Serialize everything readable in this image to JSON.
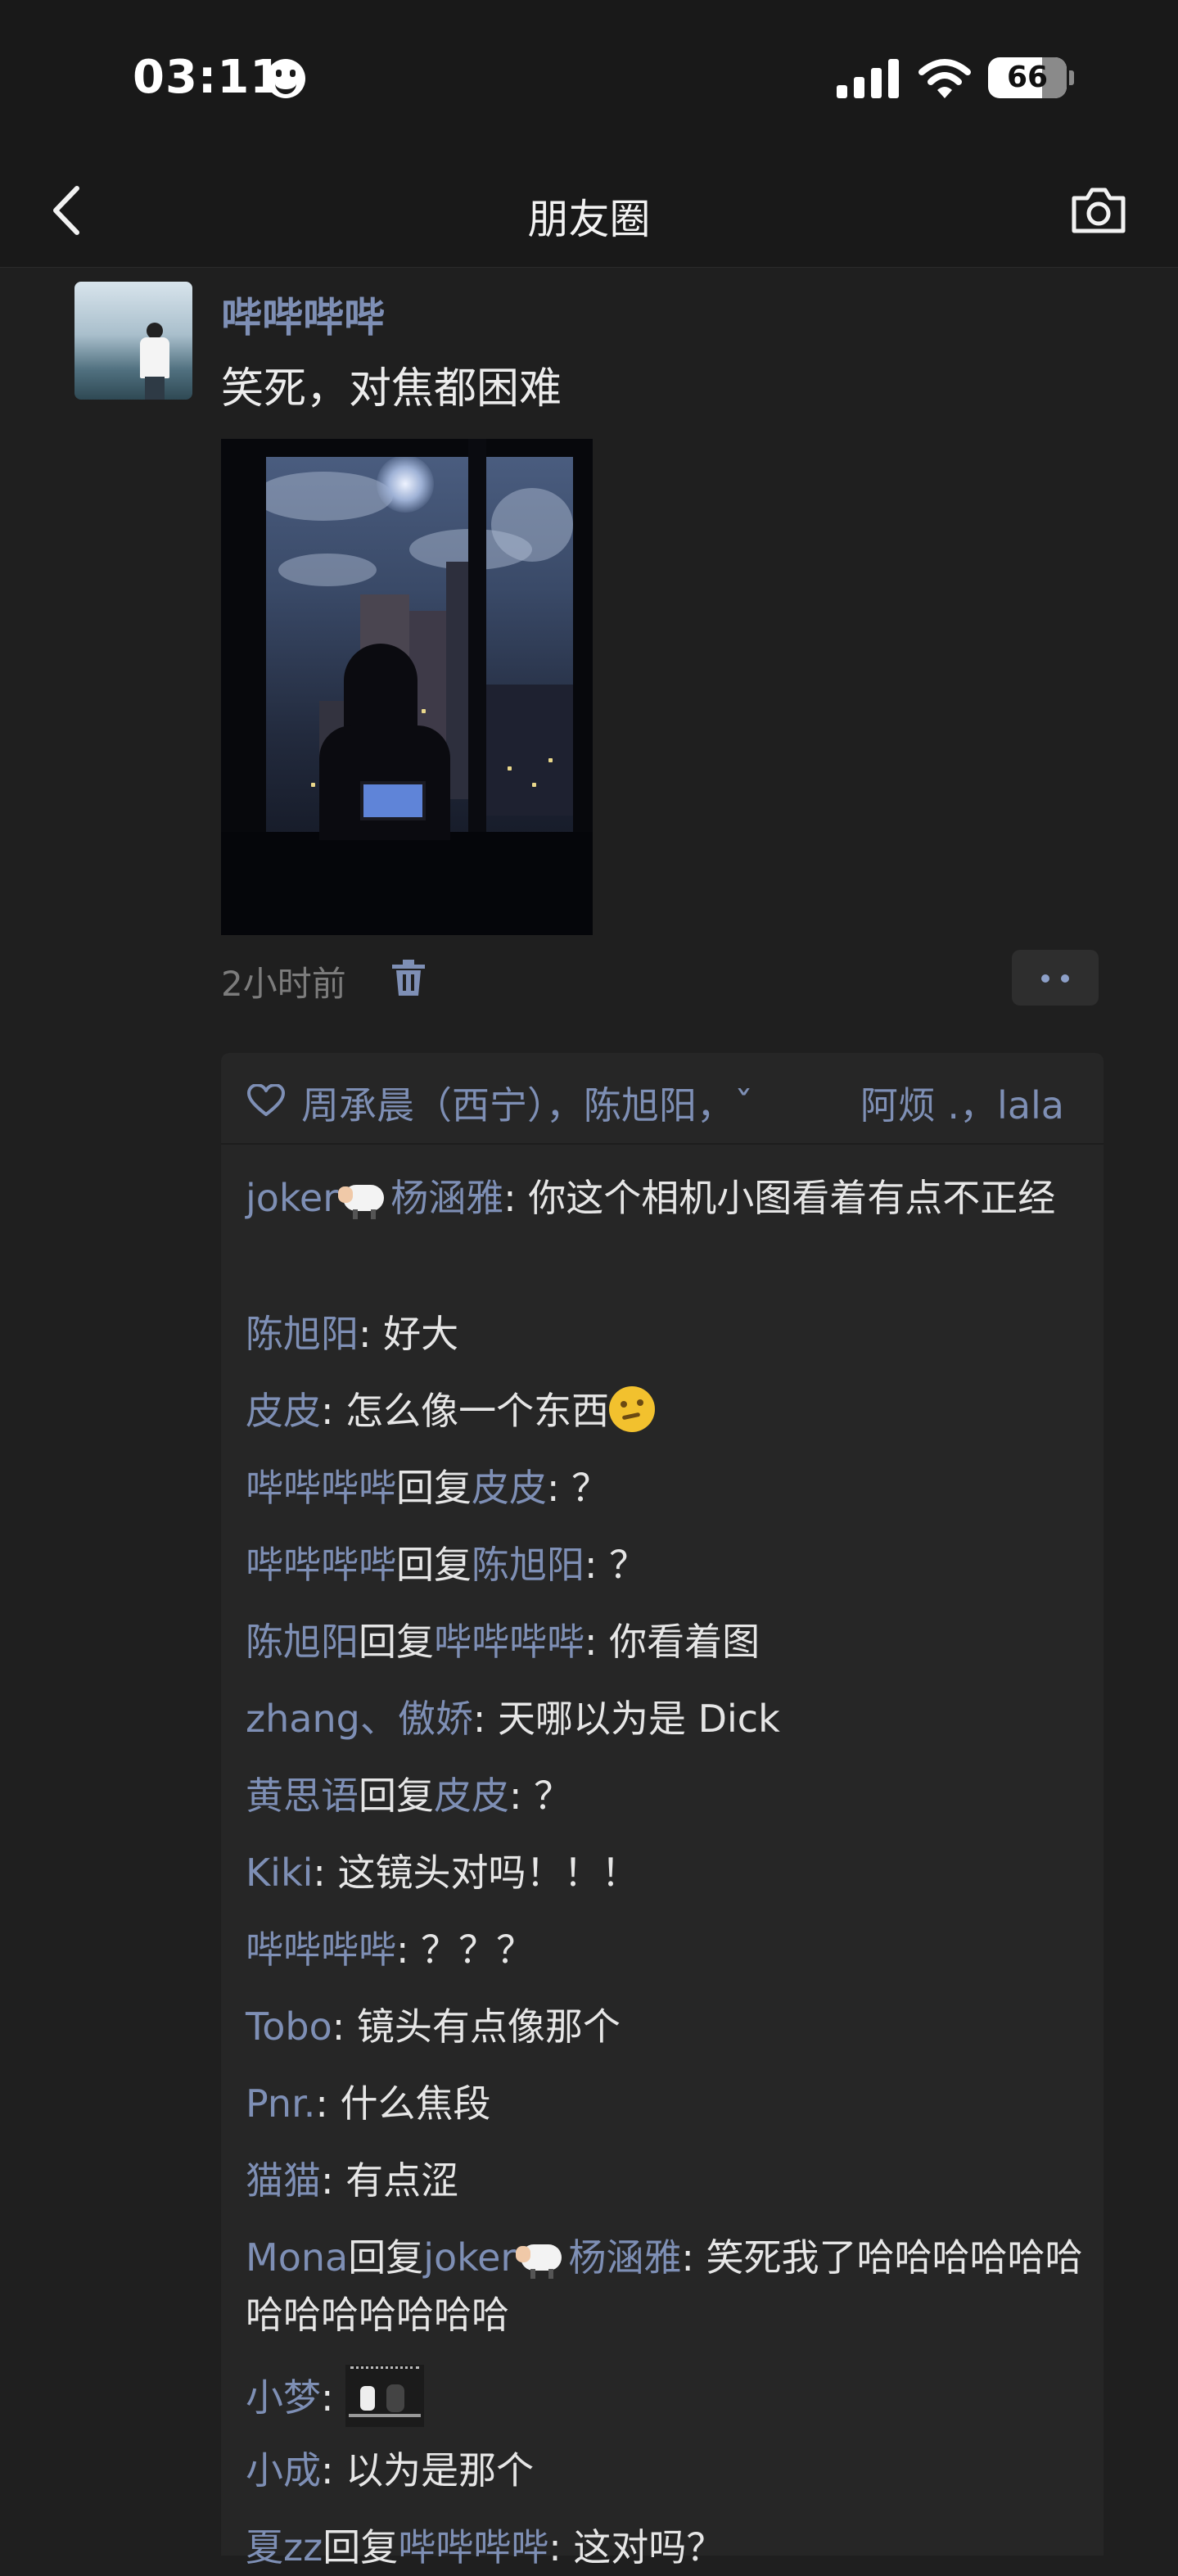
{
  "status_bar": {
    "time": "03:11",
    "battery": "66"
  },
  "nav": {
    "title": "朋友圈"
  },
  "post": {
    "author": "哔哔哔哔",
    "text": "笑死，对焦都困难",
    "time_ago": "2小时前"
  },
  "likes": {
    "names_left": "周承晨（西宁），陈旭阳，ˇ",
    "names_right": "阿烦 .，lala"
  },
  "comments": [
    {
      "from": "joker",
      "from_suffix": "杨涵雅",
      "text": "你这个相机小图看着有点不正经"
    },
    {
      "from": "陈旭阳",
      "text": "好大"
    },
    {
      "from": "皮皮",
      "text": "怎么像一个东西"
    },
    {
      "from": "哔哔哔哔",
      "reply_word": "回复",
      "to": "皮皮",
      "text": "？"
    },
    {
      "from": "哔哔哔哔",
      "reply_word": "回复",
      "to": "陈旭阳",
      "text": "？"
    },
    {
      "from": "陈旭阳",
      "reply_word": "回复",
      "to": "哔哔哔哔",
      "text": "你看着图"
    },
    {
      "from": "zhang、傲娇",
      "text": "天哪以为是 Dick"
    },
    {
      "from": "黄思语",
      "reply_word": "回复",
      "to": "皮皮",
      "text": "？"
    },
    {
      "from": "Kiki",
      "text": "这镜头对吗！！！"
    },
    {
      "from": "哔哔哔哔",
      "text": "？？？"
    },
    {
      "from": "Tobo",
      "text": "镜头有点像那个"
    },
    {
      "from": "Pnr.",
      "text": "什么焦段"
    },
    {
      "from": "猫猫",
      "text": "有点涩"
    },
    {
      "from": "Mona",
      "reply_word": "回复",
      "to": "joker",
      "to_suffix": "杨涵雅",
      "text": "笑死我了哈哈哈哈哈哈哈哈哈哈哈哈哈"
    },
    {
      "from": "小梦",
      "text": ""
    },
    {
      "from": "小成",
      "text": "以为是那个"
    },
    {
      "from": "夏zz",
      "reply_word": "回复",
      "to": "哔哔哔哔",
      "text": "这对吗？"
    }
  ],
  "colors": {
    "name": "#7e8fb5",
    "background": "#1f1f1f",
    "comment_panel": "#262626"
  },
  "icons": [
    "back-chevron-icon",
    "camera-icon",
    "trash-icon",
    "more-dots-icon",
    "heart-icon",
    "thinking-emoji-icon",
    "sheep-emoji-icon",
    "sticker-image"
  ]
}
